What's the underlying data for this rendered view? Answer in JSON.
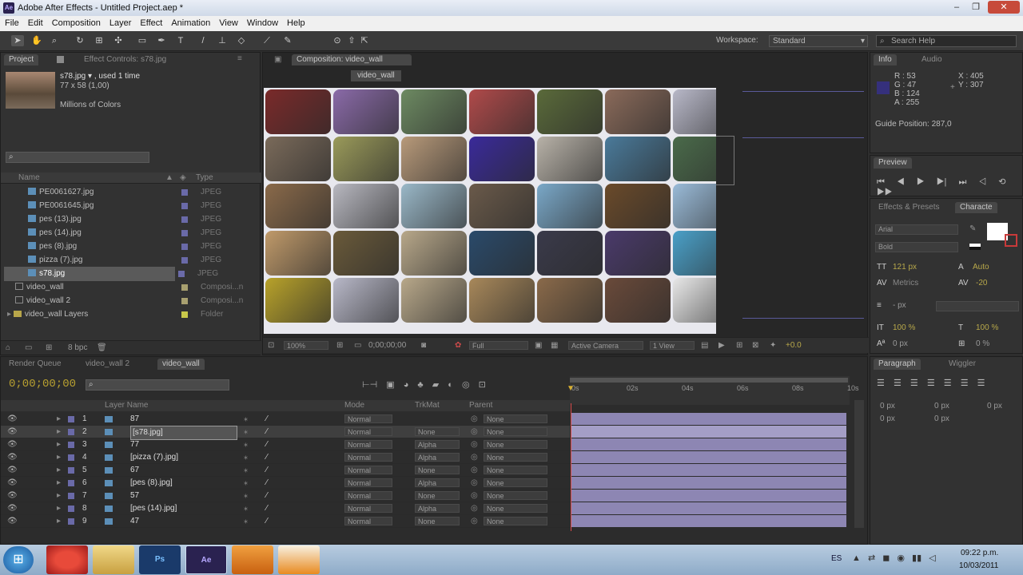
{
  "window": {
    "title": "Adobe After Effects - Untitled Project.aep *",
    "app_icon": "Ae"
  },
  "menu": [
    "File",
    "Edit",
    "Composition",
    "Layer",
    "Effect",
    "Animation",
    "View",
    "Window",
    "Help"
  ],
  "toolbar": {
    "workspace_label": "Workspace:",
    "workspace_value": "Standard",
    "search_placeholder": "Search Help"
  },
  "project": {
    "tab_project": "Project",
    "tab_effect_controls": "Effect Controls: s78.jpg",
    "selected_name": "s78.jpg ▾ , used 1 time",
    "selected_dims": "77 x 58 (1,00)",
    "selected_colors": "Millions of Colors",
    "col_name": "Name",
    "col_type": "Type",
    "items": [
      {
        "name": "PE0061627.jpg",
        "type": "JPEG",
        "kind": "file"
      },
      {
        "name": "PE0061645.jpg",
        "type": "JPEG",
        "kind": "file"
      },
      {
        "name": "pes (13).jpg",
        "type": "JPEG",
        "kind": "file"
      },
      {
        "name": "pes (14).jpg",
        "type": "JPEG",
        "kind": "file"
      },
      {
        "name": "pes (8).jpg",
        "type": "JPEG",
        "kind": "file"
      },
      {
        "name": "pizza (7).jpg",
        "type": "JPEG",
        "kind": "file"
      },
      {
        "name": "s78.jpg",
        "type": "JPEG",
        "kind": "file",
        "selected": true
      },
      {
        "name": "video_wall",
        "type": "Composi...n",
        "kind": "comp"
      },
      {
        "name": "video_wall 2",
        "type": "Composi...n",
        "kind": "comp"
      },
      {
        "name": "video_wall Layers",
        "type": "Folder",
        "kind": "folder"
      }
    ],
    "bpc": "8 bpc"
  },
  "composition": {
    "tab": "Composition: video_wall",
    "label": "video_wall",
    "thumb_colors": [
      "#7a2a2a",
      "#8a6aa8",
      "#6d8a62",
      "#b04a4a",
      "#5a6a3a",
      "#8a6a5a",
      "#b8b8c8",
      "#7a6a5a",
      "#9a9a5a",
      "#b89a7a",
      "#3a2a9a",
      "#b8b2a8",
      "#4a7a9a",
      "#4a6a4a",
      "#8a6a4a",
      "#b8b8c0",
      "#9ab8c8",
      "#6a5a4a",
      "#7aa8c8",
      "#6a4a2a",
      "#9abbd8",
      "#c09a6a",
      "#6a5a3a",
      "#b8a88a",
      "#2a4a6a",
      "#3a3a4a",
      "#4a3a6a",
      "#4aa0c8",
      "#b8a22a",
      "#b8b8c8",
      "#b8a88a",
      "#a8885a",
      "#8a6a4a",
      "#6a4a3a",
      "#e8e8e8"
    ],
    "zoom": "100%",
    "timecode": "0;00;00;00",
    "resolution": "Full",
    "camera": "Active Camera",
    "view": "1 View",
    "exposure": "+0.0"
  },
  "info": {
    "tab_info": "Info",
    "tab_audio": "Audio",
    "r": "R : 53",
    "g": "G : 47",
    "b": "B : 124",
    "a": "A : 255",
    "x": "X : 405",
    "y": "Y : 307",
    "guide": "Guide Position: 287,0"
  },
  "preview": {
    "tab": "Preview"
  },
  "character": {
    "tab_effects": "Effects & Presets",
    "tab_character": "Characte",
    "font": "Arial",
    "style": "Bold",
    "size": "121 px",
    "leading": "Auto",
    "kerning": "Metrics",
    "tracking": "-20",
    "stroke": "- px",
    "vscale": "100 %",
    "hscale": "100 %",
    "baseline": "0 px",
    "tsume": "0 %"
  },
  "paragraph": {
    "tab_paragraph": "Paragraph",
    "tab_wiggler": "Wiggler",
    "indent1": "0 px",
    "indent2": "0 px",
    "indent3": "0 px",
    "space1": "0 px",
    "space2": "0 px"
  },
  "timeline": {
    "tab_render": "Render Queue",
    "tab_vw2": "video_wall 2",
    "tab_vw": "video_wall",
    "timecode": "0;00;00;00",
    "col_layer_name": "Layer Name",
    "col_mode": "Mode",
    "col_trkmat": "TrkMat",
    "col_parent": "Parent",
    "ruler": [
      "0s",
      "02s",
      "04s",
      "06s",
      "08s",
      "10s"
    ],
    "layers": [
      {
        "num": "1",
        "name": "87",
        "mode": "Normal",
        "trk": "",
        "parent": "None"
      },
      {
        "num": "2",
        "name": "[s78.jpg]",
        "mode": "Normal",
        "trk": "None",
        "parent": "None",
        "selected": true
      },
      {
        "num": "3",
        "name": "77",
        "mode": "Normal",
        "trk": "Alpha",
        "parent": "None"
      },
      {
        "num": "4",
        "name": "[pizza (7).jpg]",
        "mode": "Normal",
        "trk": "Alpha",
        "parent": "None"
      },
      {
        "num": "5",
        "name": "67",
        "mode": "Normal",
        "trk": "None",
        "parent": "None"
      },
      {
        "num": "6",
        "name": "[pes (8).jpg]",
        "mode": "Normal",
        "trk": "Alpha",
        "parent": "None"
      },
      {
        "num": "7",
        "name": "57",
        "mode": "Normal",
        "trk": "None",
        "parent": "None"
      },
      {
        "num": "8",
        "name": "[pes (14).jpg]",
        "mode": "Normal",
        "trk": "Alpha",
        "parent": "None"
      },
      {
        "num": "9",
        "name": "47",
        "mode": "Normal",
        "trk": "None",
        "parent": "None"
      }
    ]
  },
  "taskbar": {
    "apps": [
      "Start",
      "Opera",
      "Explorer",
      "Photoshop",
      "After Effects",
      "Media Player",
      "VLC"
    ],
    "lang": "ES",
    "time": "09:22 p.m.",
    "date": "10/03/2011"
  }
}
